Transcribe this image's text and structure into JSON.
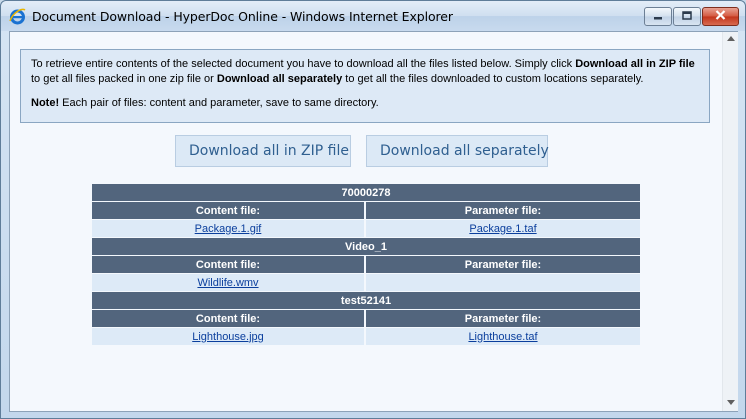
{
  "window": {
    "title": "Document Download - HyperDoc Online - Windows Internet Explorer"
  },
  "info": {
    "p1_a": "To retrieve entire contents of the selected document you have to download all the files listed below. Simply click ",
    "p1_b": "Download all in ZIP file",
    "p1_c": " to get all files packed in one zip file or ",
    "p1_d": "Download all separately",
    "p1_e": " to get all the files downloaded to custom locations separately.",
    "note_label": "Note!",
    "note_text": " Each pair of files: content and parameter, save to same directory."
  },
  "buttons": {
    "zip_label": "Download all in ZIP file",
    "separate_label": "Download all separately"
  },
  "groups": [
    {
      "name": "70000278",
      "content_header": "Content file:",
      "parameter_header": "Parameter file:",
      "content_file": "Package.1.gif",
      "parameter_file": "Package.1.taf"
    },
    {
      "name": "Video_1",
      "content_header": "Content file:",
      "parameter_header": "Parameter file:",
      "content_file": "Wildlife.wmv",
      "parameter_file": ""
    },
    {
      "name": "test52141",
      "content_header": "Content file:",
      "parameter_header": "Parameter file:",
      "content_file": "Lighthouse.jpg",
      "parameter_file": "Lighthouse.taf"
    }
  ],
  "icons": {
    "app": "internet-explorer-icon",
    "minimize": "minimize-icon",
    "maximize": "maximize-icon",
    "close": "close-icon",
    "scroll_up": "scroll-up-arrow-icon",
    "scroll_down": "scroll-down-arrow-icon"
  },
  "colors": {
    "header_bg": "#52657d",
    "cell_bg": "#ddeaf7",
    "link": "#0b3f9d",
    "button_text": "#2f5f90"
  }
}
